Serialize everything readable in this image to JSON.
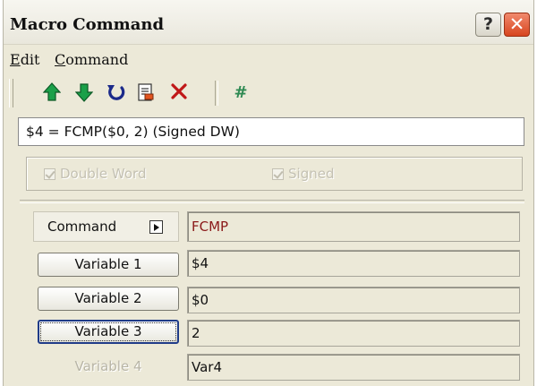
{
  "window": {
    "title": "Macro Command",
    "help_label": "?",
    "close_label": "✕"
  },
  "menu": [
    {
      "label": "Edit",
      "mnemonic": "E",
      "rest": "dit"
    },
    {
      "label": "Command",
      "mnemonic": "C",
      "rest": "ommand"
    }
  ],
  "toolbar": {
    "icons": [
      "arrow-up-icon",
      "arrow-down-icon",
      "undo-icon",
      "document-icon",
      "delete-icon",
      "hash-icon"
    ],
    "hash_label": "#",
    "colors": {
      "arrow": "#1ba049",
      "undo": "#1b2a8a",
      "delete": "#c01818",
      "hash": "#2f8a53"
    }
  },
  "expression": "$4 = FCMP($0, 2) (Signed DW)",
  "options": {
    "double_word": {
      "label": "Double Word",
      "checked": true,
      "enabled": false
    },
    "signed": {
      "label": "Signed",
      "checked": true,
      "enabled": false
    }
  },
  "command": {
    "button_label": "Command",
    "value": "FCMP"
  },
  "variables": [
    {
      "button_label": "Variable 1",
      "value": "$4",
      "enabled": true,
      "focused": false
    },
    {
      "button_label": "Variable 2",
      "value": "$0",
      "enabled": true,
      "focused": false
    },
    {
      "button_label": "Variable 3",
      "value": "2",
      "enabled": true,
      "focused": true
    },
    {
      "button_label": "Variable 4",
      "value": "Var4",
      "enabled": false,
      "focused": false
    }
  ]
}
